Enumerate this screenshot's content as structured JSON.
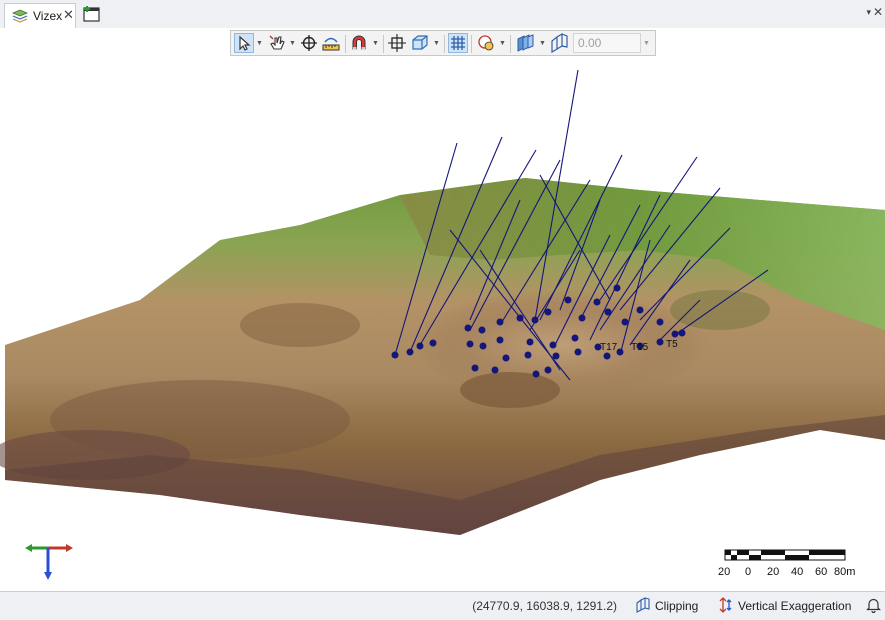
{
  "tabs": [
    {
      "label": "Vizex",
      "close": "✕",
      "icon": "layers-icon"
    }
  ],
  "tabbar": {
    "new_tab_icon": "new-window-icon",
    "dropdown": "▾",
    "close": "✕"
  },
  "toolbar": {
    "tools": [
      "select-arrow-icon",
      "pan-hand-icon",
      "crosshair-icon",
      "measure-ruler-icon",
      "magnet-snap-icon",
      "zoom-extents-icon",
      "box-view-icon",
      "grid-icon",
      "lighting-icon",
      "layers-3d-icon",
      "clipping-icon"
    ],
    "value": "0.00"
  },
  "scene": {
    "drillhole_labels": [
      "T17",
      "T15",
      "T5"
    ],
    "drillhole_color": "#14167a",
    "terrain_colors": [
      "#6d9a3c",
      "#b49266",
      "#8a6840",
      "#6b4a45"
    ]
  },
  "scale": {
    "labels": [
      "20",
      "0",
      "20",
      "40",
      "60",
      "80m"
    ]
  },
  "status": {
    "coordinates": "(24770.9, 16038.9, 1291.2)",
    "clipping_label": "Clipping",
    "vertical_exaggeration_label": "Vertical Exaggeration"
  }
}
